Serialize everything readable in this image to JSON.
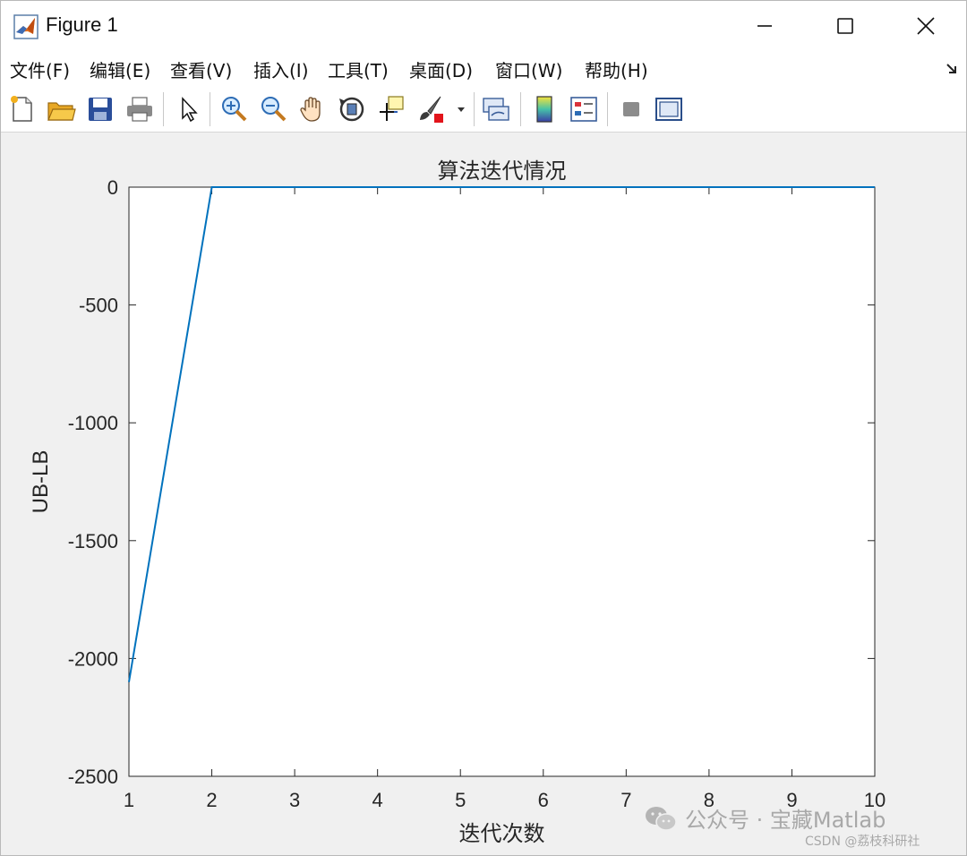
{
  "window": {
    "title": "Figure 1"
  },
  "menu": {
    "items": [
      "文件(F)",
      "编辑(E)",
      "查看(V)",
      "插入(I)",
      "工具(T)",
      "桌面(D)",
      "窗口(W)",
      "帮助(H)"
    ]
  },
  "toolbar": {
    "icons": [
      "new-figure-icon",
      "open-file-icon",
      "save-icon",
      "print-icon",
      "pointer-icon",
      "zoom-in-icon",
      "zoom-out-icon",
      "pan-hand-icon",
      "rotate-3d-icon",
      "data-cursor-icon",
      "brush-icon",
      "brush-dropdown-icon",
      "link-plot-icon",
      "colorbar-icon",
      "legend-icon",
      "hide-tools-icon",
      "show-tools-icon"
    ]
  },
  "chart_data": {
    "type": "line",
    "title": "算法迭代情况",
    "xlabel": "迭代次数",
    "ylabel": "UB-LB",
    "xlim": [
      1,
      10
    ],
    "ylim": [
      -2500,
      0
    ],
    "xticks": [
      "1",
      "2",
      "3",
      "4",
      "5",
      "6",
      "7",
      "8",
      "9",
      "10"
    ],
    "yticks": [
      "0",
      "-500",
      "-1000",
      "-1500",
      "-2000",
      "-2500"
    ],
    "x": [
      1,
      2,
      3,
      4,
      5,
      6,
      7,
      8,
      9,
      10
    ],
    "y": [
      -2100,
      0,
      0,
      0,
      0,
      0,
      0,
      0,
      0,
      0
    ],
    "line_color": "#0072bd",
    "grid": false
  },
  "watermark": {
    "main": "公众号 · 宝藏Matlab",
    "sub": "CSDN @荔枝科研社"
  }
}
